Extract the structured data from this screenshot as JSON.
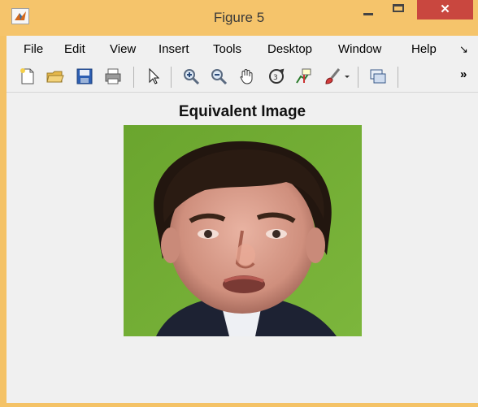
{
  "window": {
    "title": "Figure 5",
    "close_label": "✕"
  },
  "menu": {
    "items": [
      "File",
      "Edit",
      "View",
      "Insert",
      "Tools",
      "Desktop",
      "Window",
      "Help"
    ],
    "overflow": "↘"
  },
  "toolbar": {
    "icons": [
      "new-figure-icon",
      "open-file-icon",
      "save-icon",
      "print-icon",
      "select-pointer-icon",
      "zoom-in-icon",
      "zoom-out-icon",
      "pan-hand-icon",
      "rotate-3d-icon",
      "data-cursor-icon",
      "brush-icon",
      "brush-dropdown-icon",
      "link-plot-icon"
    ],
    "overflow": "»"
  },
  "figure": {
    "axes_title": "Equivalent Image"
  },
  "colors": {
    "titlebar": "#f5c46b",
    "close_button": "#c9473f",
    "background": "#f0f0f0",
    "image_background": "#6fa634"
  }
}
